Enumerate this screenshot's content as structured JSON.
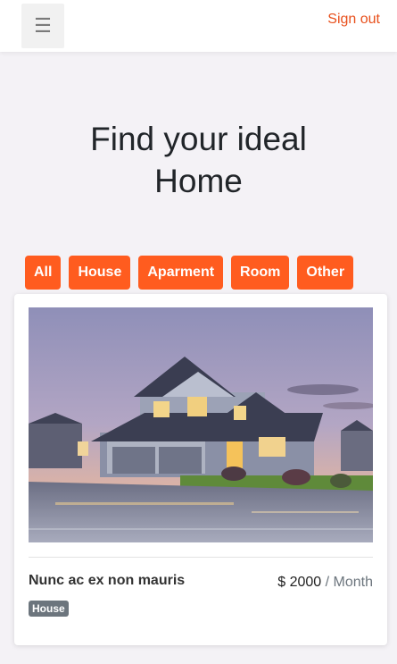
{
  "header": {
    "menu_icon": "hamburger-icon",
    "menu_glyph": "☰",
    "signout_label": "Sign out",
    "accent_color": "#e8501c"
  },
  "hero": {
    "title_line1": "Find your ideal",
    "title_line2": "Home"
  },
  "filters": [
    {
      "label": "All"
    },
    {
      "label": "House"
    },
    {
      "label": "Aparment"
    },
    {
      "label": "Room"
    },
    {
      "label": "Other"
    }
  ],
  "filter_color": "#ff5c1f",
  "listing": {
    "image": "house-photo",
    "title": "Nunc ac ex non mauris",
    "price": "$ 2000",
    "price_unit": "/ Month",
    "badge": "House"
  }
}
